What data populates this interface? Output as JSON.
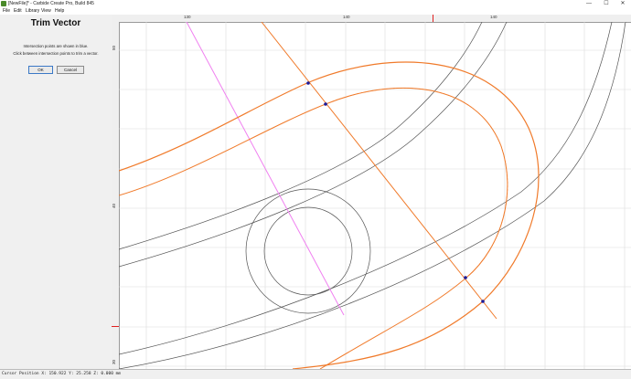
{
  "window": {
    "title": "[NewFile]* - Carbide Create Pro, Build 845",
    "minimize_glyph": "—",
    "maximize_glyph": "☐",
    "close_glyph": "✕"
  },
  "menu": [
    "File",
    "Edit",
    "Library",
    "View",
    "Help"
  ],
  "panel": {
    "title": "Trim Vector",
    "line1": "Intersection points are shown in blue.",
    "line2": "Click between intersection points to trim a vector.",
    "ok_label": "OK",
    "cancel_label": "Cancel"
  },
  "ruler": {
    "top_labels": [
      "130",
      "140",
      "140"
    ],
    "left_labels": [
      "50",
      "40",
      "30"
    ]
  },
  "status": {
    "cursor_text": "Cursor Position X: 150.922 Y: 25.258 Z: 0.000 mm"
  },
  "colors": {
    "orange": "#f07a2a",
    "magenta": "#f080f0",
    "gray_curve": "#555555",
    "intersection": "#1a1a9a",
    "grid": "#dcdcdc"
  }
}
